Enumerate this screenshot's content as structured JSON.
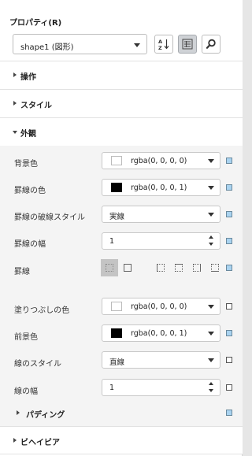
{
  "panel": {
    "title": "プロパティ(R)",
    "object_select": {
      "value": "shape1 (図形)"
    },
    "toolbar": {
      "sort_icon": "sort-az-icon",
      "categorized_icon": "categorized-list-icon",
      "search_icon": "search-icon",
      "categorized_active": true
    }
  },
  "sections": {
    "operation": "操作",
    "style": "スタイル",
    "appearance": "外観",
    "behavior": "ビヘイビア"
  },
  "appearance": {
    "background_color": {
      "label": "背景色",
      "value": "rgba(0, 0, 0, 0)",
      "swatch": "#ffffff"
    },
    "border_color": {
      "label": "罫線の色",
      "value": "rgba(0, 0, 0, 1)",
      "swatch": "#000000"
    },
    "border_dash_style": {
      "label": "罫線の破線スタイル",
      "value": "実線"
    },
    "border_width": {
      "label": "罫線の幅",
      "value": "1"
    },
    "borders": {
      "label": "罫線"
    },
    "fill_color": {
      "label": "塗りつぶしの色",
      "value": "rgba(0, 0, 0, 0)",
      "swatch": "#ffffff"
    },
    "foreground_color": {
      "label": "前景色",
      "value": "rgba(0, 0, 0, 1)",
      "swatch": "#000000"
    },
    "line_style": {
      "label": "線のスタイル",
      "value": "直線"
    },
    "line_width": {
      "label": "線の幅",
      "value": "1"
    },
    "padding": {
      "label": "パディング"
    }
  },
  "colors": {
    "indicator_on": "#a9d3f0",
    "selected_button": "#c4c4c4",
    "body_background": "#f4f4f4"
  }
}
